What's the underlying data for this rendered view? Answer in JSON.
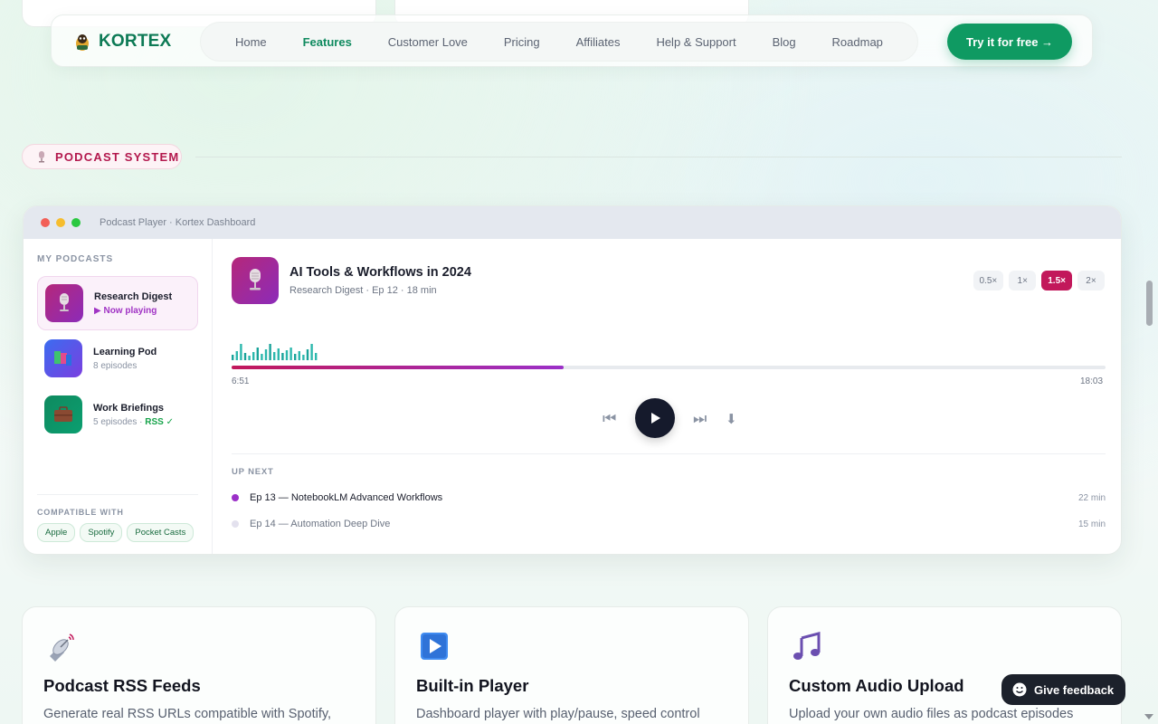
{
  "nav": {
    "logo_text": "KORTEX",
    "links": [
      "Home",
      "Features",
      "Customer Love",
      "Pricing",
      "Affiliates",
      "Help & Support",
      "Blog",
      "Roadmap"
    ],
    "active_link": "Features",
    "cta_label": "Try it for free →"
  },
  "section": {
    "tag": "PODCAST SYSTEM"
  },
  "window": {
    "title": "Podcast Player · Kortex Dashboard",
    "sidebar": {
      "heading": "MY PODCASTS",
      "podcasts": [
        {
          "name": "Research Digest",
          "sub": "▶ Now playing",
          "icon": "microphone-icon"
        },
        {
          "name": "Learning Pod",
          "sub": "8 episodes",
          "icon": "books-icon"
        },
        {
          "name": "Work Briefings",
          "sub": "5 episodes · ",
          "rss": "RSS ✓",
          "icon": "briefcase-icon"
        }
      ],
      "compat_heading": "COMPATIBLE WITH",
      "compat": [
        "Apple",
        "Spotify",
        "Pocket Casts"
      ]
    },
    "player": {
      "title": "AI Tools & Workflows in 2024",
      "meta": "Research Digest · Ep 12 · 18 min",
      "speeds": [
        "0.5×",
        "1×",
        "1.5×",
        "2×"
      ],
      "active_speed": "1.5×",
      "current_time": "6:51",
      "total_time": "18:03",
      "progress": 0.38
    },
    "up_next": {
      "heading": "UP NEXT",
      "items": [
        {
          "title": "Ep 13 — NotebookLM Advanced Workflows",
          "duration": "22 min"
        },
        {
          "title": "Ep 14 — Automation Deep Dive",
          "duration": "15 min"
        }
      ]
    }
  },
  "features": [
    {
      "title": "Podcast RSS Feeds",
      "desc": "Generate real RSS URLs compatible with Spotify,",
      "icon": "satellite-dish-icon"
    },
    {
      "title": "Built-in Player",
      "desc": "Dashboard player with play/pause, speed control",
      "icon": "play-button-icon"
    },
    {
      "title": "Custom Audio Upload",
      "desc": "Upload your own audio files as podcast episodes",
      "icon": "music-note-icon"
    }
  ],
  "feedback_label": "Give feedback",
  "colors": {
    "brand": "#0f9a62",
    "accent": "#c2185b",
    "podcast_purple": "#9b30c8"
  }
}
